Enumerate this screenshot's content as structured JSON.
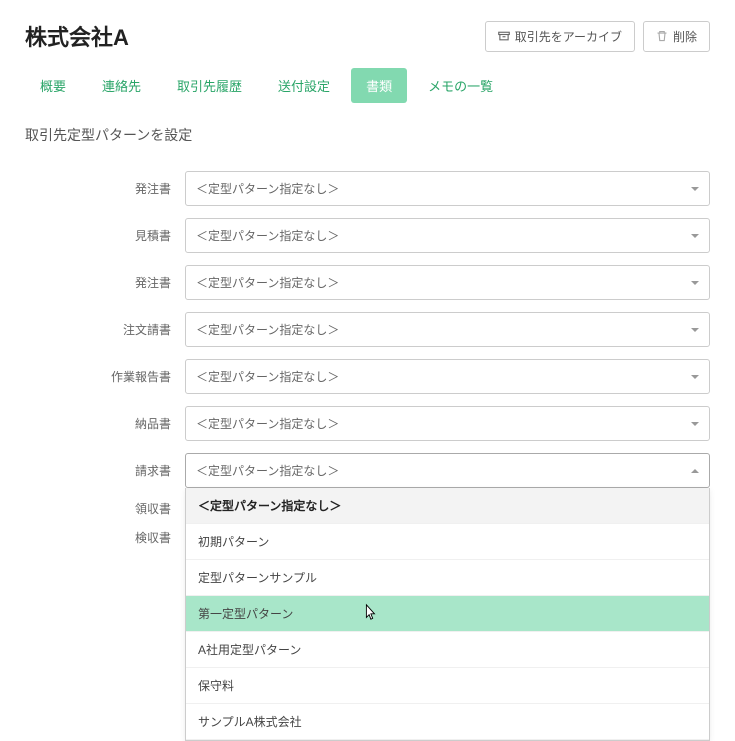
{
  "header": {
    "title": "株式会社A",
    "archive_label": "取引先をアーカイブ",
    "delete_label": "削除"
  },
  "tabs": [
    {
      "label": "概要"
    },
    {
      "label": "連絡先"
    },
    {
      "label": "取引先履歴"
    },
    {
      "label": "送付設定"
    },
    {
      "label": "書類"
    },
    {
      "label": "メモの一覧"
    }
  ],
  "section_title": "取引先定型パターンを設定",
  "placeholder": "＜定型パターン指定なし＞",
  "rows": [
    {
      "label": "発注書"
    },
    {
      "label": "見積書"
    },
    {
      "label": "発注書"
    },
    {
      "label": "注文請書"
    },
    {
      "label": "作業報告書"
    },
    {
      "label": "納品書"
    },
    {
      "label": "請求書"
    },
    {
      "label": "領収書"
    },
    {
      "label": "検収書"
    }
  ],
  "dropdown_options": [
    "＜定型パターン指定なし＞",
    "初期パターン",
    "定型パターンサンプル",
    "第一定型パターン",
    "A社用定型パターン",
    "保守料",
    "サンプルA株式会社"
  ]
}
